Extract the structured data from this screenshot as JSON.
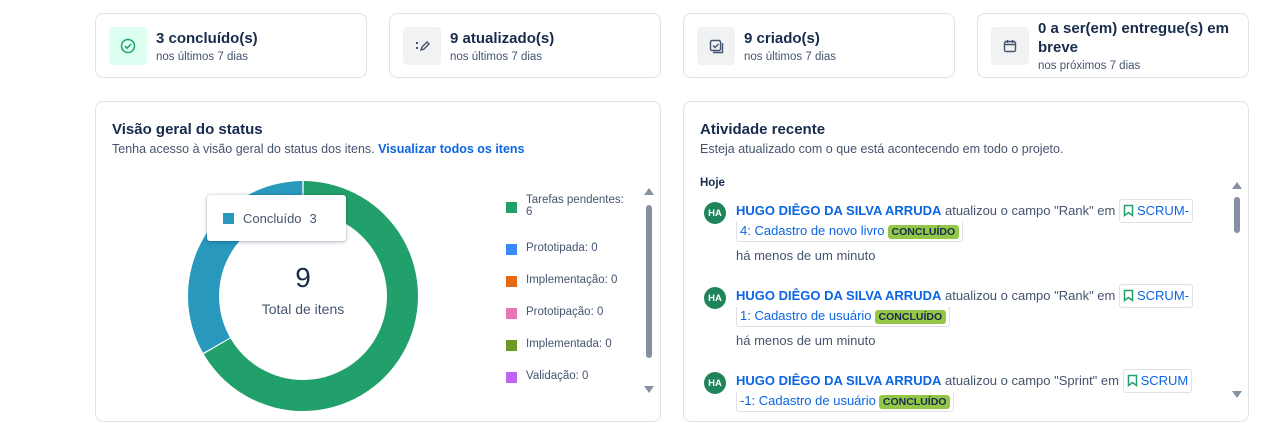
{
  "stats": [
    {
      "value": "3 concluído(s)",
      "sub": "nos últimos 7 dias",
      "icon": "check-circle-icon"
    },
    {
      "value": "9 atualizado(s)",
      "sub": "nos últimos 7 dias",
      "icon": "edit-list-icon"
    },
    {
      "value": "9 criado(s)",
      "sub": "nos últimos 7 dias",
      "icon": "checkbox-icon"
    },
    {
      "value_line1": "0 a ser(em) entregue(s) em",
      "value_line2": "breve",
      "sub": "nos próximos 7 dias",
      "icon": "calendar-icon"
    }
  ],
  "status": {
    "title": "Visão geral do status",
    "subtitle": "Tenha acesso à visão geral do status dos itens.",
    "link": "Visualizar todos os itens",
    "total": "9",
    "total_label": "Total de itens",
    "tooltip": {
      "label": "Concluído",
      "value": "3"
    },
    "legend": [
      {
        "label_line1": "Tarefas pendentes:",
        "label_line2": "6",
        "color": "#22a06b"
      },
      {
        "label": "Prototipada: 0",
        "color": "#388bff"
      },
      {
        "label": "Implementação: 0",
        "color": "#e56910"
      },
      {
        "label": "Prototipação: 0",
        "color": "#e774bb"
      },
      {
        "label": "Implementada: 0",
        "color": "#6a9a23"
      },
      {
        "label": "Validação: 0",
        "color": "#bf63f3"
      }
    ]
  },
  "chart_data": {
    "type": "pie",
    "categories": [
      "Tarefas pendentes",
      "Concluído",
      "Prototipada",
      "Implementação",
      "Prototipação",
      "Implementada",
      "Validação"
    ],
    "values": [
      6,
      3,
      0,
      0,
      0,
      0,
      0
    ],
    "colors": [
      "#22a06b",
      "#2898bd",
      "#388bff",
      "#e56910",
      "#e774bb",
      "#6a9a23",
      "#bf63f3"
    ],
    "total": 9
  },
  "activity": {
    "title": "Atividade recente",
    "subtitle": "Esteja atualizado com o que está acontecendo em todo o projeto.",
    "day": "Hoje",
    "items": [
      {
        "avatar": "HA",
        "user": "HUGO DIÊGO DA SILVA ARRUDA",
        "action": "atualizou o campo \"Rank\" em",
        "issue_a": "SCRUM-",
        "issue_b": "4: Cadastro de novo livro",
        "status": "CONCLUÍDO",
        "time": "há menos de um minuto"
      },
      {
        "avatar": "HA",
        "user": "HUGO DIÊGO DA SILVA ARRUDA",
        "action": "atualizou o campo \"Rank\" em",
        "issue_a": "SCRUM-",
        "issue_b": "1: Cadastro de usuário",
        "status": "CONCLUÍDO",
        "time": "há menos de um minuto"
      },
      {
        "avatar": "HA",
        "user": "HUGO DIÊGO DA SILVA ARRUDA",
        "action": "atualizou o campo \"Sprint\" em",
        "issue_a": "SCRUM",
        "issue_b": "-1: Cadastro de usuário",
        "status": "CONCLUÍDO"
      }
    ]
  }
}
